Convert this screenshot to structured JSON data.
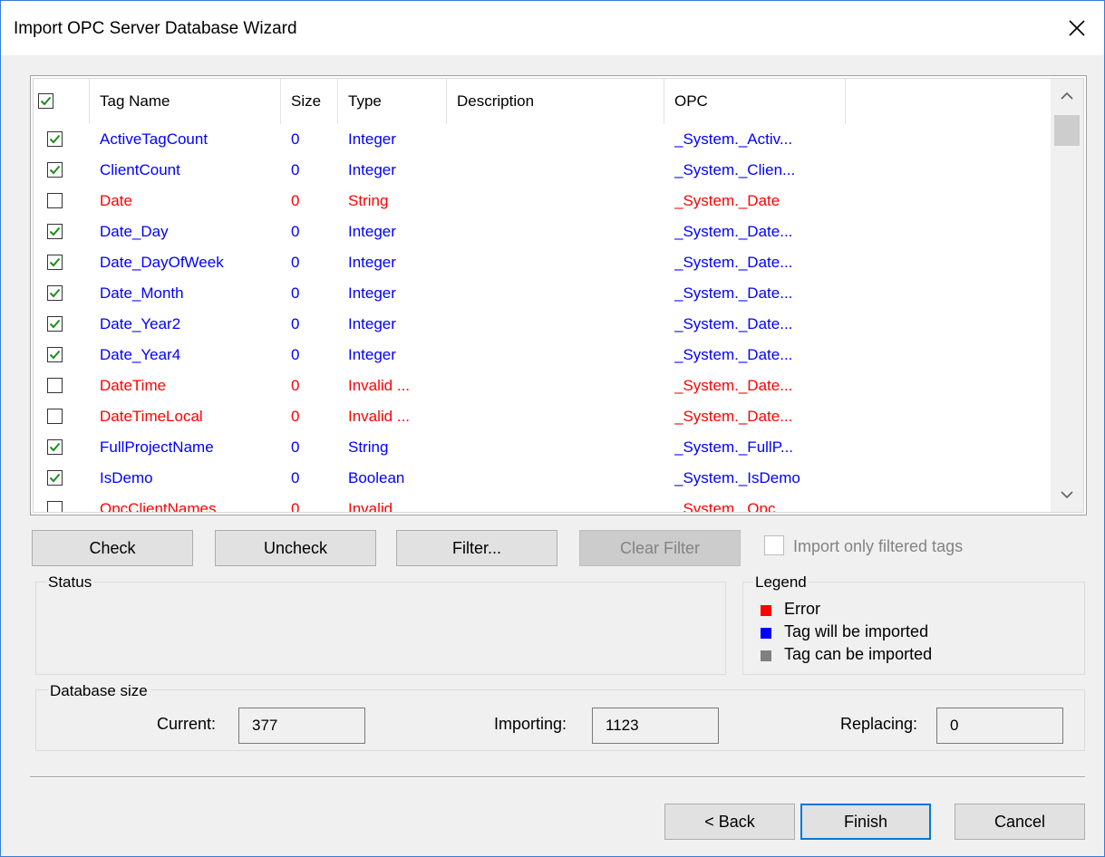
{
  "window": {
    "title": "Import OPC Server Database Wizard"
  },
  "table": {
    "headers": {
      "tag_name": "Tag Name",
      "size": "Size",
      "type": "Type",
      "description": "Description",
      "opc": "OPC"
    },
    "header_checked": true,
    "rows": [
      {
        "checked": true,
        "state": "import",
        "tag_name": "ActiveTagCount",
        "size": "0",
        "type": "Integer",
        "description": "",
        "opc": "_System._Activ..."
      },
      {
        "checked": true,
        "state": "import",
        "tag_name": "ClientCount",
        "size": "0",
        "type": "Integer",
        "description": "",
        "opc": "_System._Clien..."
      },
      {
        "checked": false,
        "state": "error",
        "tag_name": "Date",
        "size": "0",
        "type": "String",
        "description": "",
        "opc": "_System._Date"
      },
      {
        "checked": true,
        "state": "import",
        "tag_name": "Date_Day",
        "size": "0",
        "type": "Integer",
        "description": "",
        "opc": "_System._Date..."
      },
      {
        "checked": true,
        "state": "import",
        "tag_name": "Date_DayOfWeek",
        "size": "0",
        "type": "Integer",
        "description": "",
        "opc": "_System._Date..."
      },
      {
        "checked": true,
        "state": "import",
        "tag_name": "Date_Month",
        "size": "0",
        "type": "Integer",
        "description": "",
        "opc": "_System._Date..."
      },
      {
        "checked": true,
        "state": "import",
        "tag_name": "Date_Year2",
        "size": "0",
        "type": "Integer",
        "description": "",
        "opc": "_System._Date..."
      },
      {
        "checked": true,
        "state": "import",
        "tag_name": "Date_Year4",
        "size": "0",
        "type": "Integer",
        "description": "",
        "opc": "_System._Date..."
      },
      {
        "checked": false,
        "state": "error",
        "tag_name": "DateTime",
        "size": "0",
        "type": "Invalid ...",
        "description": "",
        "opc": "_System._Date..."
      },
      {
        "checked": false,
        "state": "error",
        "tag_name": "DateTimeLocal",
        "size": "0",
        "type": "Invalid ...",
        "description": "",
        "opc": "_System._Date..."
      },
      {
        "checked": true,
        "state": "import",
        "tag_name": "FullProjectName",
        "size": "0",
        "type": "String",
        "description": "",
        "opc": "_System._FullP..."
      },
      {
        "checked": true,
        "state": "import",
        "tag_name": "IsDemo",
        "size": "0",
        "type": "Boolean",
        "description": "",
        "opc": "_System._IsDemo"
      },
      {
        "checked": false,
        "state": "error",
        "tag_name": "OpcClientNames",
        "size": "0",
        "type": "Invalid",
        "description": "",
        "opc": "_System._Opc..."
      }
    ]
  },
  "buttons": {
    "check": "Check",
    "uncheck": "Uncheck",
    "filter": "Filter...",
    "clear_filter": "Clear Filter",
    "back": "< Back",
    "finish": "Finish",
    "cancel": "Cancel"
  },
  "import_only_filtered": {
    "label": "Import only filtered tags",
    "checked": false
  },
  "status": {
    "title": "Status",
    "text": ""
  },
  "legend": {
    "title": "Legend",
    "items": [
      {
        "label": "Error",
        "color": "#ff0000"
      },
      {
        "label": "Tag will be imported",
        "color": "#0000ff"
      },
      {
        "label": "Tag can be imported",
        "color": "#808080"
      }
    ]
  },
  "database_size": {
    "title": "Database size",
    "current_label": "Current:",
    "current_value": "377",
    "importing_label": "Importing:",
    "importing_value": "1123",
    "replacing_label": "Replacing:",
    "replacing_value": "0"
  },
  "colors": {
    "error": "#ff0000",
    "import": "#0000ff",
    "check_green": "#1a8f1a",
    "accent": "#0078d7"
  }
}
